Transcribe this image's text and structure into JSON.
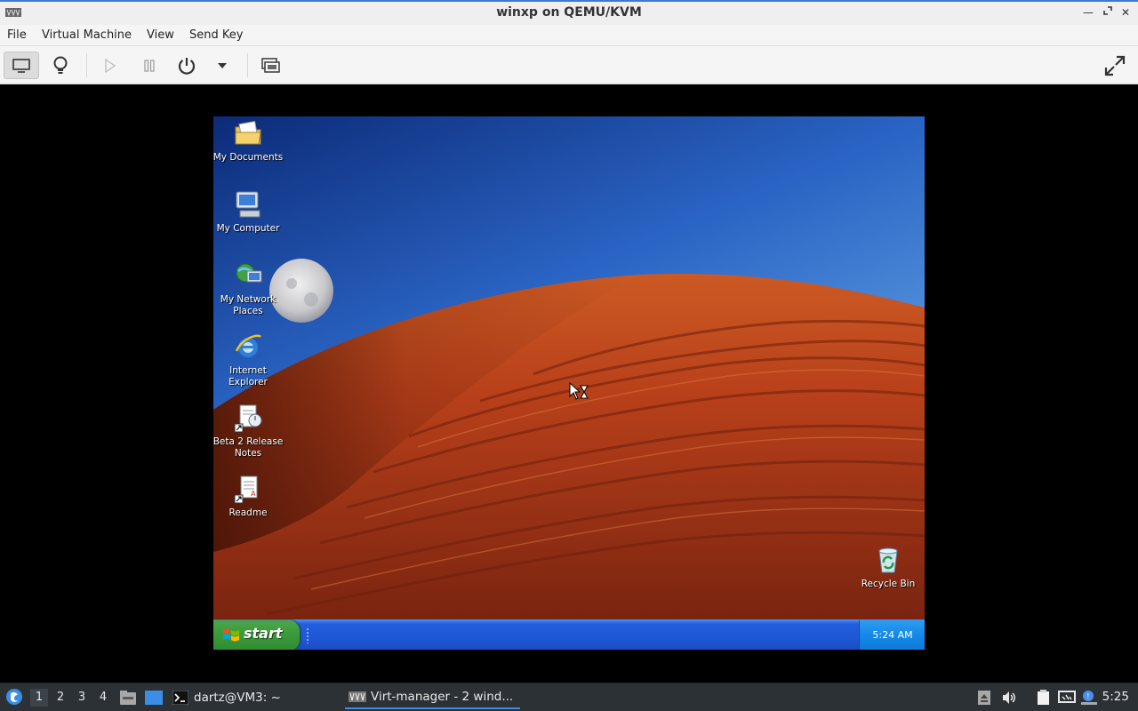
{
  "window": {
    "title": "winxp on QEMU/KVM",
    "controls": [
      "minimize-icon",
      "restore-icon",
      "close-icon"
    ]
  },
  "menubar": {
    "items": [
      "File",
      "Virtual Machine",
      "View",
      "Send Key"
    ]
  },
  "toolbar": {
    "buttons": [
      "console-icon",
      "lightbulb-icon",
      "play-icon",
      "pause-icon",
      "power-icon",
      "dropdown-icon",
      "snapshot-icon"
    ],
    "right": "fullscreen-icon"
  },
  "guest": {
    "desktop_icons": [
      {
        "label": "My Documents",
        "icon": "folder-icon"
      },
      {
        "label": "My Computer",
        "icon": "computer-icon"
      },
      {
        "label": "My Network Places",
        "icon": "network-icon"
      },
      {
        "label": "Internet Explorer",
        "icon": "ie-icon"
      },
      {
        "label": "Beta 2 Release Notes",
        "icon": "notes-shortcut-icon"
      },
      {
        "label": "Readme",
        "icon": "readme-shortcut-icon"
      },
      {
        "label": "Recycle Bin",
        "icon": "recycle-bin-icon"
      }
    ],
    "taskbar": {
      "start_label": "start",
      "clock": "5:24 AM"
    },
    "colors": {
      "sky_top": "#0c2b78",
      "sky_bottom": "#5aa2e6",
      "dune": "#b8401a",
      "taskbar": "#245edc",
      "start": "#3c9c3c"
    }
  },
  "panel": {
    "workspaces": [
      "1",
      "2",
      "3",
      "4"
    ],
    "current_workspace": "1",
    "tasks": [
      {
        "label": "dartz@VM3: ~",
        "icon": "terminal-icon"
      },
      {
        "label": "Virt-manager - 2 wind...",
        "icon": "virt-manager-icon"
      }
    ],
    "clock": "5:25",
    "tray": [
      "eject-icon",
      "volume-icon",
      "clipboard-icon",
      "network-icon",
      "notification-icon"
    ]
  }
}
